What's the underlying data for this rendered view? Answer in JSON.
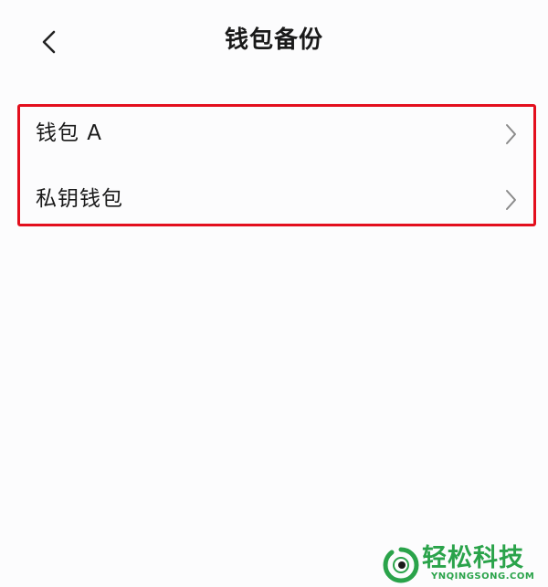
{
  "header": {
    "title": "钱包备份",
    "back_icon": "chevron-left-icon"
  },
  "wallets": [
    {
      "label": "钱包 A",
      "icon": "chevron-right-icon"
    },
    {
      "label": "私钥钱包",
      "icon": "chevron-right-icon"
    }
  ],
  "highlight": {
    "border_color": "#e30f1d"
  },
  "watermark": {
    "title": "轻松科技",
    "subtitle": "YNQINGSONG.COM",
    "color": "#2aa34a"
  }
}
